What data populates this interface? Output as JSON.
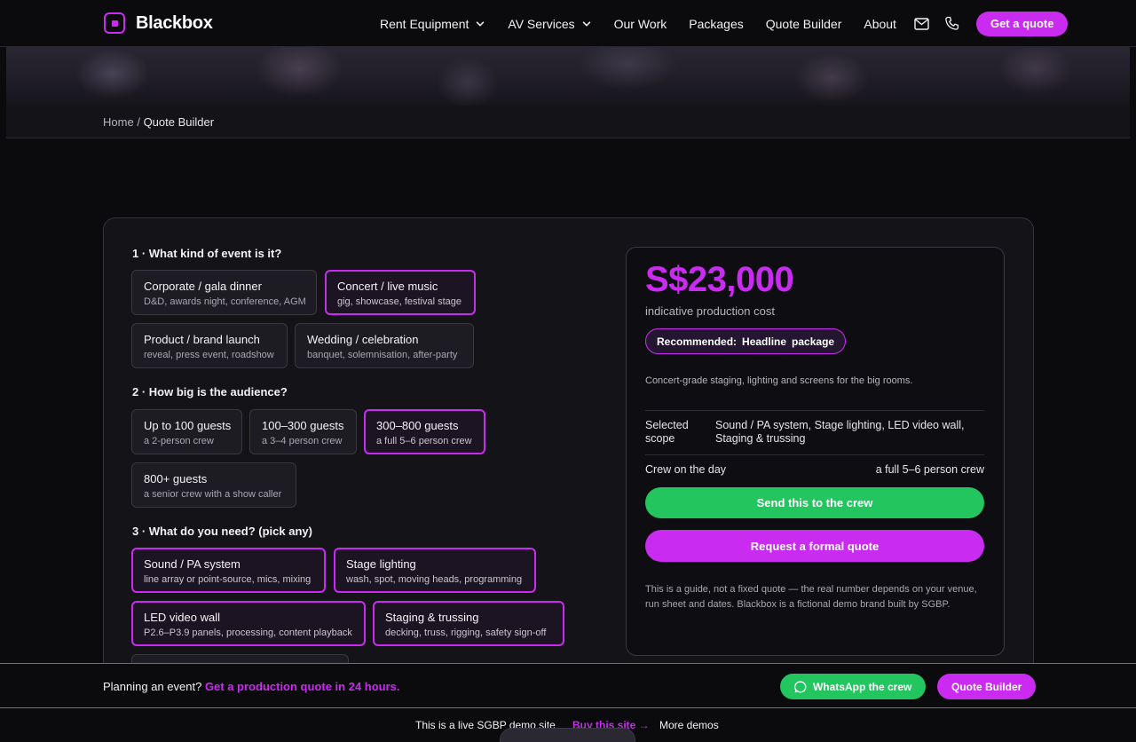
{
  "brand": {
    "name": "Blackbox",
    "accent": "#c92cf0"
  },
  "nav": {
    "items": [
      {
        "label": "Rent Equipment",
        "dropdown": true
      },
      {
        "label": "AV Services",
        "dropdown": true
      },
      {
        "label": "Our Work"
      },
      {
        "label": "Packages"
      },
      {
        "label": "Quote Builder"
      },
      {
        "label": "About"
      }
    ],
    "icons": [
      "mail-icon",
      "phone-icon"
    ],
    "cta": "Get a quote"
  },
  "breadcrumb": {
    "home": "Home",
    "separator": "/",
    "current": "Quote Builder"
  },
  "builder": {
    "q1": {
      "title": "1 · What kind of event is it?",
      "options": [
        {
          "title": "Corporate / gala dinner",
          "sub": "D&D, awards night, conference, AGM",
          "selected": false
        },
        {
          "title": "Concert / live music",
          "sub": "gig, showcase, festival stage",
          "selected": true
        },
        {
          "title": "Product / brand launch",
          "sub": "reveal, press event, roadshow",
          "selected": false
        },
        {
          "title": "Wedding / celebration",
          "sub": "banquet, solemnisation, after-party",
          "selected": false
        }
      ]
    },
    "q2": {
      "title": "2 · How big is the audience?",
      "options": [
        {
          "title": "Up to 100 guests",
          "sub": "a 2-person crew",
          "selected": false
        },
        {
          "title": "100–300 guests",
          "sub": "a 3–4 person crew",
          "selected": false
        },
        {
          "title": "300–800 guests",
          "sub": "a full 5–6 person crew",
          "selected": true
        },
        {
          "title": "800+ guests",
          "sub": "a senior crew with a show caller",
          "selected": false
        }
      ]
    },
    "q3": {
      "title": "3 · What do you need? (pick any)",
      "options": [
        {
          "title": "Sound / PA system",
          "sub": "line array or point-source, mics, mixing",
          "selected": true
        },
        {
          "title": "Stage lighting",
          "sub": "wash, spot, moving heads, programming",
          "selected": true
        },
        {
          "title": "LED video wall",
          "sub": "P2.6–P3.9 panels, processing, content playback",
          "selected": true
        },
        {
          "title": "Staging & trussing",
          "sub": "decking, truss, rigging, safety sign-off",
          "selected": true
        }
      ]
    }
  },
  "estimate": {
    "price": "S$23,000",
    "price_label": "indicative production cost",
    "rec_prefix": "Recommended:",
    "rec_name": "Headline",
    "rec_suffix": "package",
    "package_desc": "Concert-grade staging, lighting and screens for the big rooms.",
    "scope_label_1": "Selected",
    "scope_label_2": "scope",
    "scope_value_1": "Sound / PA system, Stage lighting, LED video wall,",
    "scope_value_2": "Staging & trussing",
    "crew_label": "Crew on the day",
    "crew_value": "a full 5–6 person crew",
    "send_btn": "Send this to the crew",
    "formal_btn": "Request a formal quote",
    "disclaimer": "This is a guide, not a fixed quote — the real number depends on your venue, run sheet and dates. Blackbox is a fictional demo brand built by SGBP."
  },
  "sticky": {
    "lead": "Planning an event?",
    "link": "Get a production quote in 24 hours.",
    "whatsapp": "WhatsApp the crew",
    "quote_builder": "Quote Builder"
  },
  "demo_bar": {
    "text": "This is a live SGBP demo site",
    "buy": "Buy this site →",
    "more": "More demos"
  },
  "colors": {
    "accent": "#c92cf0",
    "success": "#22c55e",
    "bg": "#0b0a0d",
    "card": "#141318"
  }
}
